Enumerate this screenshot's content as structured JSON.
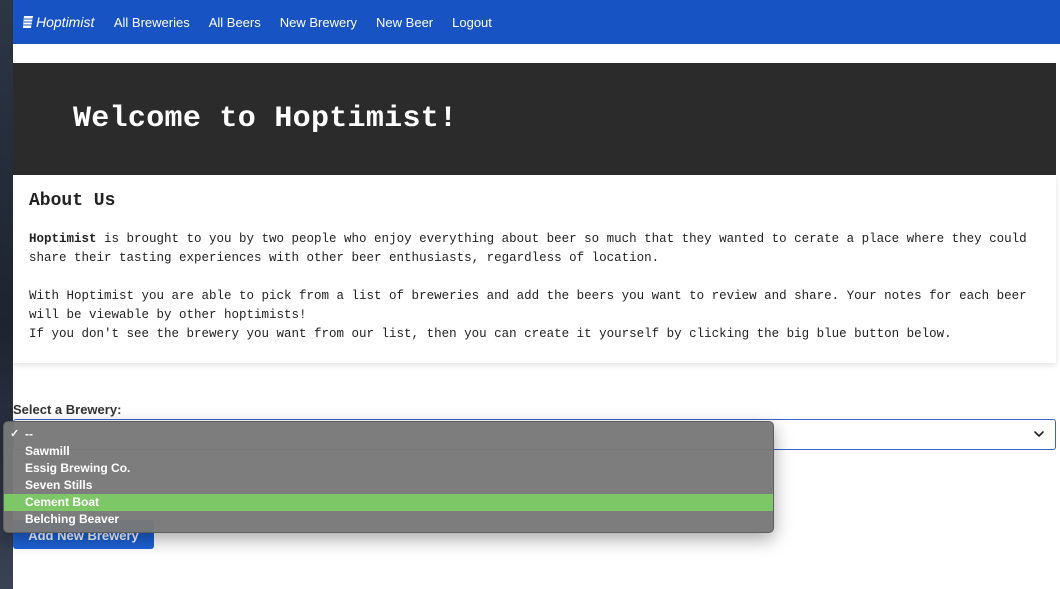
{
  "nav": {
    "brand": "Hoptimist",
    "links": [
      "All Breweries",
      "All Beers",
      "New Brewery",
      "New Beer",
      "Logout"
    ]
  },
  "hero": {
    "title": "Welcome to Hoptimist!"
  },
  "about": {
    "heading": "About Us",
    "p1_bold": "Hoptimist",
    "p1_rest": " is brought to you by two people who enjoy everything about beer so much that they wanted to cerate a place where they could share their tasting experiences with other beer enthusiasts, regardless of location.",
    "p2_line1": "With Hoptimist you are able to pick from a list of breweries and add the beers you want to review and share. Your notes for each beer will be viewable by other hoptimists!",
    "p2_line2": "If you don't see the brewery you want from our list, then you can create it yourself by clicking the big blue button below."
  },
  "form": {
    "select_label": "Select a Brewery:",
    "selected": "--",
    "options": [
      "--",
      "Sawmill",
      "Essig Brewing Co.",
      "Seven Stills",
      "Cement Boat",
      "Belching Beaver"
    ],
    "highlighted": "Cement Boat",
    "add_button": "Add New Brewery"
  },
  "colors": {
    "navbar": "#1753c2",
    "hero_bg": "#2b2b2b",
    "highlight": "#7dc767",
    "button": "#1d62d6"
  }
}
